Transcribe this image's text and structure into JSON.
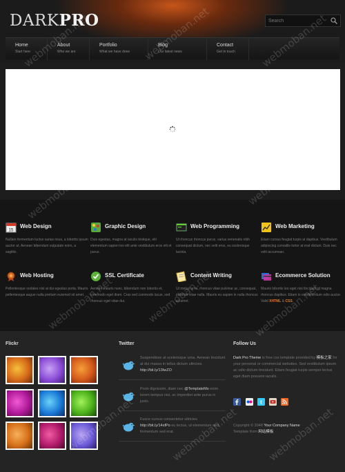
{
  "header": {
    "logo": {
      "light": "DARK",
      "bold": "PRO"
    },
    "search": {
      "placeholder": "Search"
    }
  },
  "nav": [
    {
      "title": "Home",
      "subtitle": "Start here"
    },
    {
      "title": "About",
      "subtitle": "Who we are"
    },
    {
      "title": "Portfolio",
      "subtitle": "What we have done"
    },
    {
      "title": "Blog",
      "subtitle": "Our latest news"
    },
    {
      "title": "Contact",
      "subtitle": "Get in touch"
    }
  ],
  "services": [
    {
      "title": "Web Design",
      "icon": "calendar-icon",
      "text": "Nullam fermentum luctus varius risus, a lobortis ipsum auctor at. Aenean bibendum vulputate enim, a sagittis."
    },
    {
      "title": "Graphic Design",
      "icon": "palette-icon",
      "text": "Duis egestas, magna at iaculis tristique, elit elementum sapien leo elit ante vestibulum eros elit et purus."
    },
    {
      "title": "Web Programming",
      "icon": "terminal-icon",
      "text": "Ut rhoncus rhoncus purus, varius venenatis nibh consequat dictum, nec velit eros, eu scelerisque lacinia."
    },
    {
      "title": "Web Marketing",
      "icon": "chart-icon",
      "text": "Etiam cursus feugiat turpis at dapibus. Vestibulum adipiscing convallis tortor at erat dictum. Duis nec velit accumsan."
    },
    {
      "title": "Web Hosting",
      "icon": "award-icon",
      "text": "Pellentesque sodales nisl at dui egestas porta. Mauris pellentesque augue nulla pretium euismod sit amet."
    },
    {
      "title": "SSL Certificate",
      "icon": "check-icon",
      "text": "Aenean mauris nunc, bibendum non lobortis et, commodo eget diam. Cras sed commodo lacus, sed rhoncus eget vitae dui."
    },
    {
      "title": "Content Writing",
      "icon": "document-icon",
      "text": "Ut metus urna, rhoncus vitae pulvinar ac, consequat, pulvinar vitae nulla. Mauris eu sapien in nulla rhoncus sit amet."
    },
    {
      "title": "Ecommerce Solution",
      "icon": "cards-icon",
      "text": "Mauris lobortis leo eget nisi tincidunt id magna rhoncus dapibus. Etiam in condimentum odio auctor. Valid",
      "hl1": "XHTML",
      "mid": " & ",
      "hl2": "CSS",
      "end": "."
    }
  ],
  "flickr": {
    "title": "Flickr"
  },
  "twitter": {
    "title": "Twitter",
    "tweets": [
      {
        "text": "Suspendisse at scelerisque urna. Aenean tincidunt at dui massa in tellus dictum ultricies.",
        "link": "http://bit.ly/13IwZO"
      },
      {
        "text": "Proin dignissim, diam nec",
        "link": "@TemplateMo",
        "rest": "enim lorem tempus nisi, ac imperdiet ante purus in justo."
      },
      {
        "text": "Fusce cursus consectetur ultricies",
        "link": "http://bit.ly/14sfPo",
        "rest": "eu lectus, ut elementum sed, fermentum sed erat."
      }
    ]
  },
  "follow": {
    "title": "Follow Us",
    "theme_name": "Dark Pro Theme",
    "text1": " is free css template provided by ",
    "provider": "模板之家",
    "text2": " for your personal or commercial websites. Sed vestibulum ipsum ac odio dictum tincidunt. Etiam feugiat turpis semper lectus eget diam posuere iaculis.",
    "social_icons": [
      "facebook-icon",
      "flickr-icon",
      "twitter-icon",
      "youtube-icon",
      "rss-icon"
    ]
  },
  "copyright": {
    "prefix": "Copyright © 2048 ",
    "company": "Your Company Name",
    "template": "Template from ",
    "source": "网站模板"
  },
  "watermark": "webmoban.net",
  "colors": {
    "accent": "#e07a25",
    "background": "#1d1d1d",
    "header_glow": "#c5551a"
  }
}
